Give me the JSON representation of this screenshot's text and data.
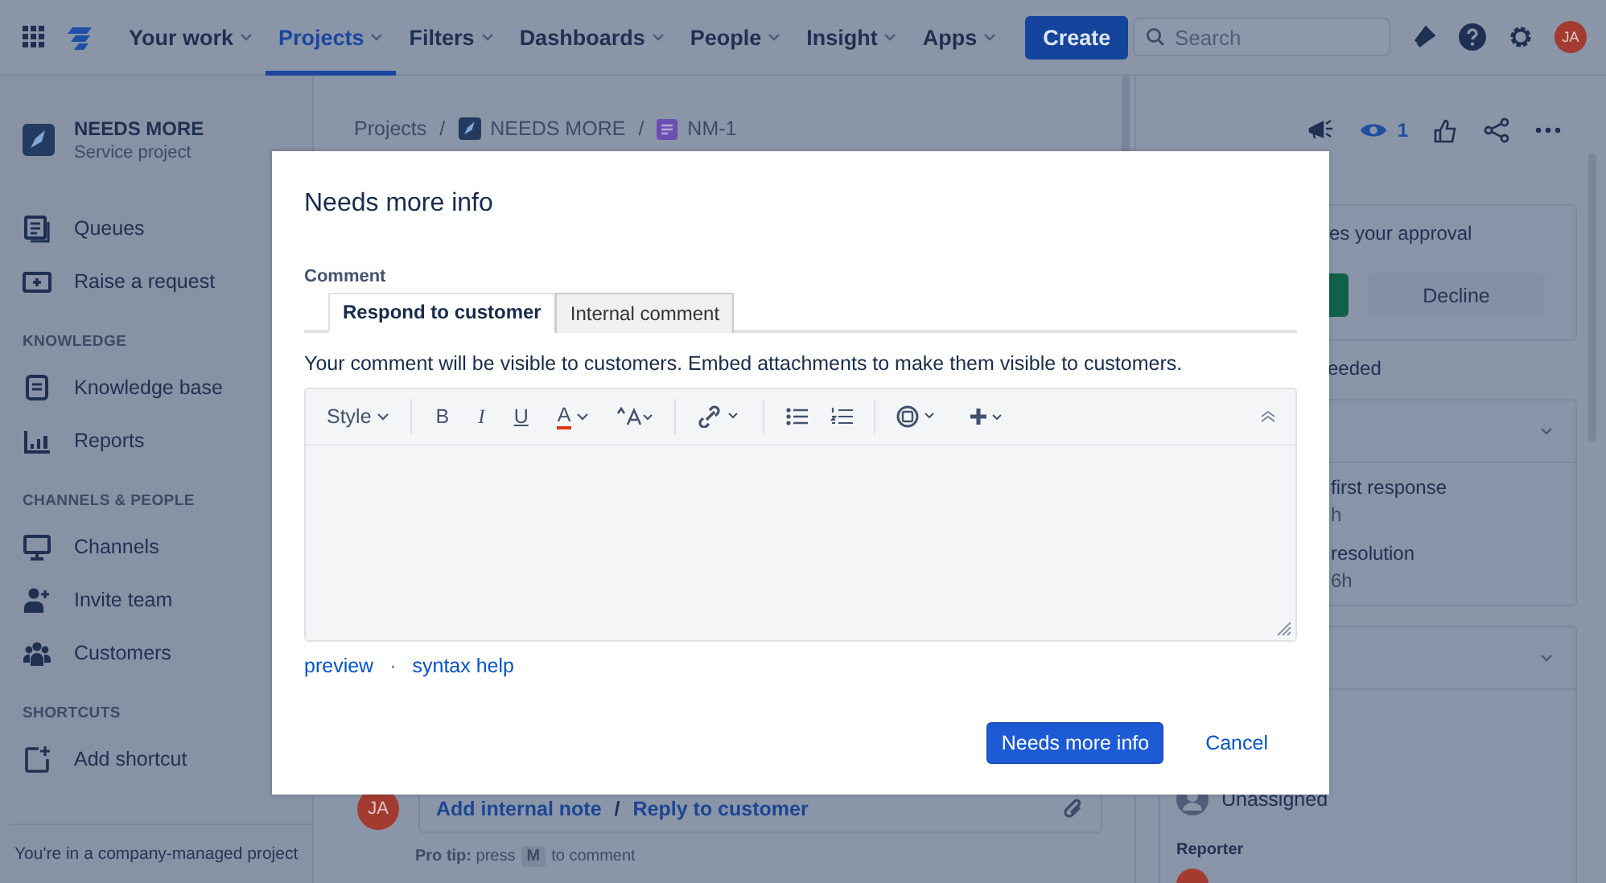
{
  "nav": {
    "items": [
      {
        "label": "Your work",
        "selected": false
      },
      {
        "label": "Projects",
        "selected": true
      },
      {
        "label": "Filters",
        "selected": false
      },
      {
        "label": "Dashboards",
        "selected": false
      },
      {
        "label": "People",
        "selected": false
      },
      {
        "label": "Insight",
        "selected": false
      },
      {
        "label": "Apps",
        "selected": false
      }
    ],
    "create": "Create",
    "search": {
      "placeholder": "Search"
    },
    "avatar": "JA"
  },
  "sidebar": {
    "project": {
      "name": "NEEDS MORE",
      "type": "Service project"
    },
    "sections": [
      {
        "items": [
          "Queues",
          "Raise a request"
        ]
      },
      {
        "heading": "KNOWLEDGE",
        "items": [
          "Knowledge base",
          "Reports"
        ]
      },
      {
        "heading": "CHANNELS & PEOPLE",
        "items": [
          "Channels",
          "Invite team",
          "Customers"
        ]
      },
      {
        "heading": "SHORTCUTS",
        "items": [
          "Add shortcut"
        ]
      }
    ],
    "footer": "You're in a company-managed project"
  },
  "breadcrumb": [
    "Projects",
    "NEEDS MORE",
    "NM-1"
  ],
  "breadcrumb_separator": "/",
  "comment_bar": {
    "avatar": "JA",
    "actions": [
      "Add internal note",
      "Reply to customer"
    ],
    "separator": "/",
    "tip": "**Pro tip:** press",
    "key": "M",
    "tip_end": "to comment"
  },
  "issue_actions": {
    "watchers": "1"
  },
  "approval": {
    "text": "es your approval",
    "decline": "Decline",
    "note": "eeded"
  },
  "sla": {
    "items": [
      {
        "title": "first response",
        "time": "h"
      },
      {
        "title": "resolution",
        "time": "6h"
      }
    ]
  },
  "people": {
    "assignee": "Unassigned",
    "reporter_label": "Reporter"
  },
  "modal": {
    "title": "Needs more info",
    "comment_label": "Comment",
    "tabs": [
      {
        "label": "Respond to customer",
        "selected": true
      },
      {
        "label": "Internal comment",
        "selected": false
      }
    ],
    "hint": "Your comment will be visible to customers. Embed attachments to make them visible to customers.",
    "toolbar": {
      "style": "Style",
      "format": [
        "B",
        "I",
        "U",
        "A"
      ]
    },
    "links": [
      "preview",
      "syntax help"
    ],
    "separator": "·",
    "submit": "Needs more info",
    "cancel": "Cancel"
  }
}
